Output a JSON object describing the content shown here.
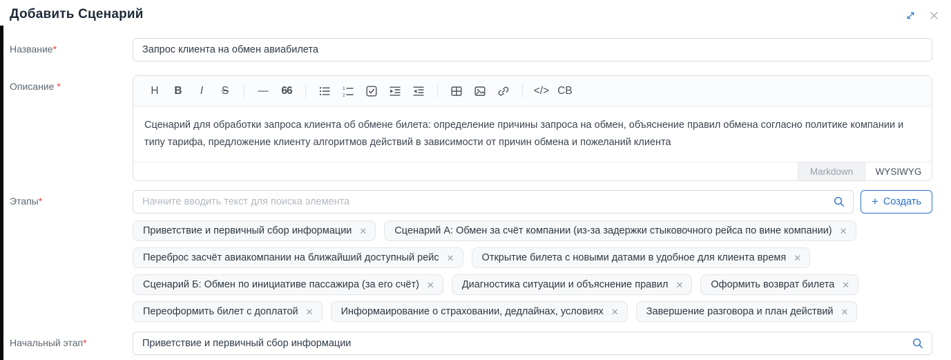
{
  "window": {
    "title": "Добавить Сценарий"
  },
  "colors": {
    "accent_blue": "#2b72c8",
    "required_red": "#e8403a",
    "tag_background": "#f7f8f9",
    "border_gray": "#dcdfe4"
  },
  "fields": {
    "name": {
      "label": "Название",
      "required_mark": "*",
      "value": "Запрос клиента на обмен авиабилета"
    },
    "description": {
      "label": "Описание ",
      "required_mark": "*",
      "text": "Сценарий для обработки запроса клиента об обмене билета: определение причины запроса на обмен, объяснение правил обмена согласно политике компании и типу тарифа, предложение клиенту алгоритмов действий в зависимости от причин обмена и пожеланий клиента",
      "mode_tabs": [
        {
          "label": "Markdown",
          "active": false
        },
        {
          "label": "WYSIWYG",
          "active": true
        }
      ]
    },
    "stages": {
      "label": "Этапы",
      "required_mark": "*",
      "search_placeholder": "Начните вводить текст для поиска элемента",
      "create_button": {
        "icon": "plus-icon",
        "glyph": "+",
        "label": "Создать"
      },
      "tags": [
        "Приветствие и первичный сбор информации",
        "Сценарий А: Обмен за счёт компании (из-за задержки стыковочного рейса по вине компании)",
        "Переброс засчёт авиакомпании на ближайший доступный рейс",
        "Открытие билета с новыми датами в удобное для клиента время",
        "Сценарий Б: Обмен по инициативе пассажира (за его счёт)",
        "Диагностика ситуации и объяснение правил",
        "Оформить возврат билета",
        "Переоформить билет с доплатой",
        "Информаирование о страховании, дедлайнах, условиях",
        "Завершение разговора и план действий"
      ]
    },
    "initial_stage": {
      "label": "Начальный этап",
      "required_mark": "*",
      "value": "Приветствие и первичный сбор информации"
    }
  },
  "editor_toolbar": [
    {
      "icon": "heading-icon",
      "glyph": "H"
    },
    {
      "icon": "bold-icon",
      "glyph": "B"
    },
    {
      "icon": "italic-icon",
      "glyph": "I"
    },
    {
      "icon": "strike-icon",
      "glyph": "S"
    },
    {
      "icon": "toolbar-divider",
      "divider": true
    },
    {
      "icon": "horizontal-rule-icon",
      "glyph": "—"
    },
    {
      "icon": "blockquote-icon",
      "glyph": "66"
    },
    {
      "icon": "toolbar-divider",
      "divider": true
    },
    {
      "icon": "bullet-list-icon",
      "svg": "ul"
    },
    {
      "icon": "ordered-list-icon",
      "svg": "ol"
    },
    {
      "icon": "task-list-icon",
      "svg": "task"
    },
    {
      "icon": "indent-icon",
      "svg": "indent"
    },
    {
      "icon": "outdent-icon",
      "svg": "outdent"
    },
    {
      "icon": "toolbar-divider",
      "divider": true
    },
    {
      "icon": "table-icon",
      "svg": "table"
    },
    {
      "icon": "image-icon",
      "svg": "image"
    },
    {
      "icon": "link-icon",
      "svg": "link"
    },
    {
      "icon": "toolbar-divider",
      "divider": true
    },
    {
      "icon": "code-icon",
      "glyph": "</>"
    },
    {
      "icon": "codeblock-icon",
      "glyph": "CB"
    }
  ]
}
